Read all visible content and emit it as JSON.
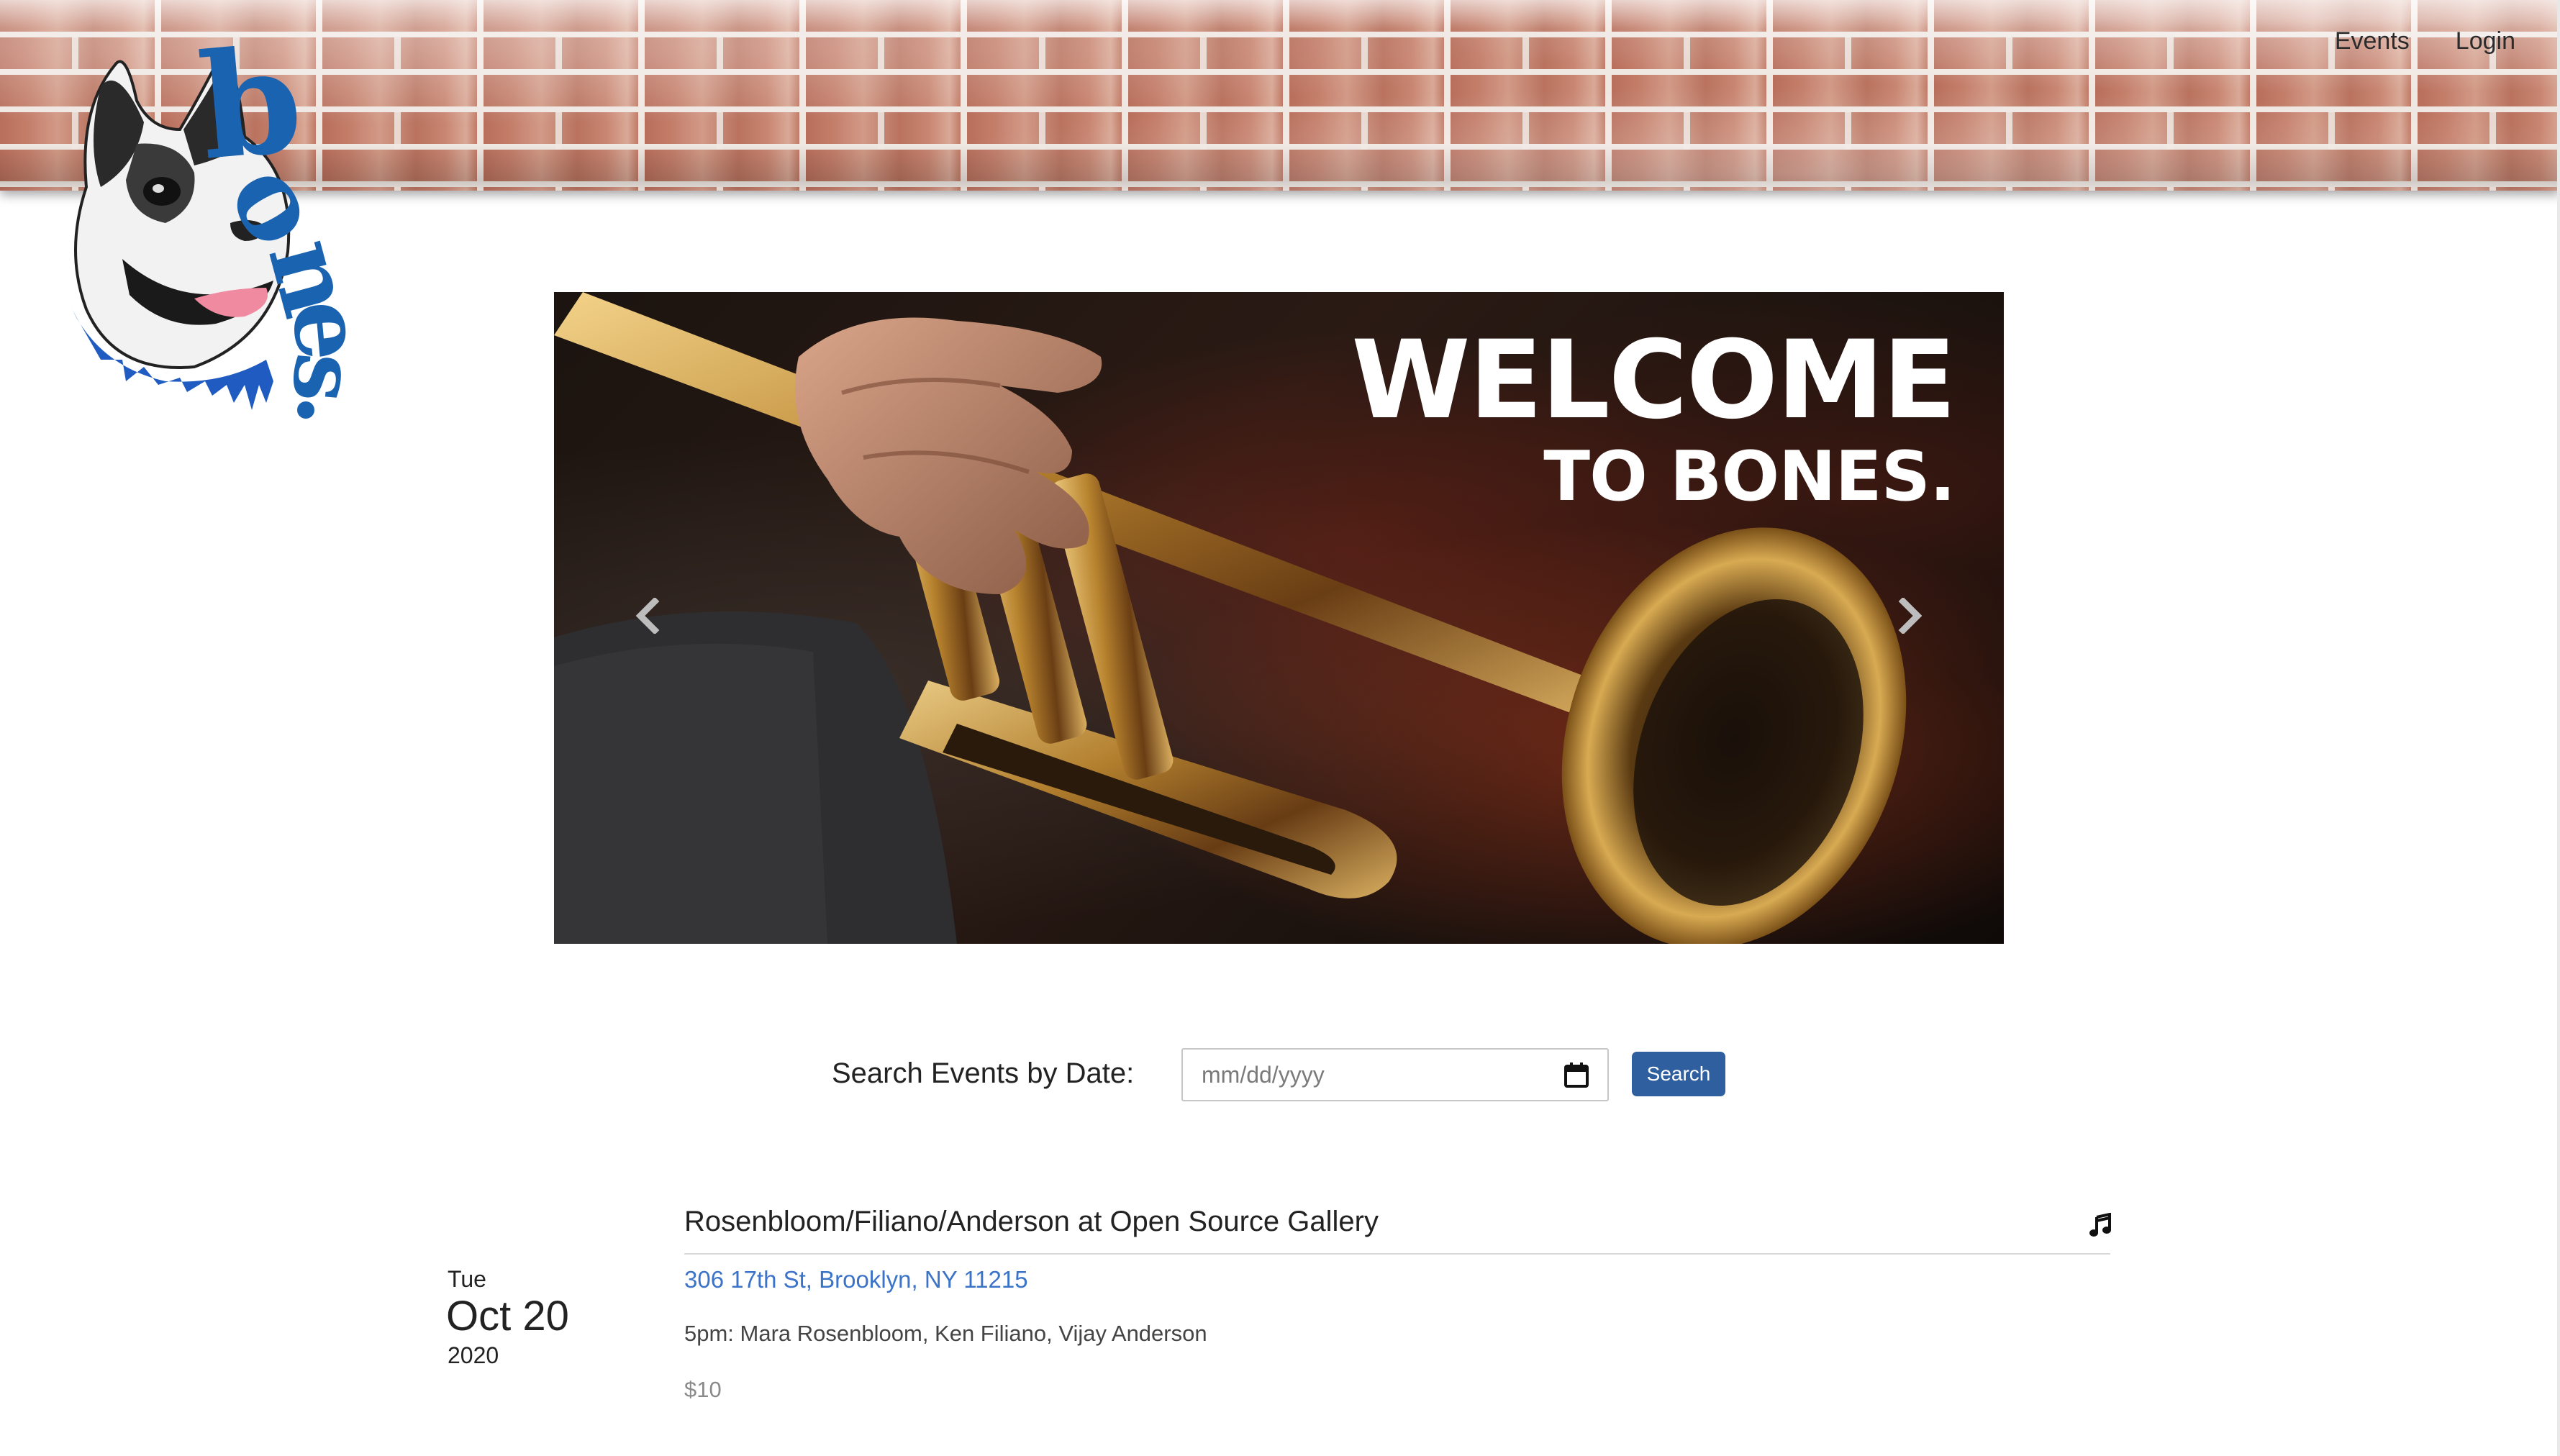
{
  "nav": {
    "events": "Events",
    "login": "Login"
  },
  "logo": {
    "text": "bones."
  },
  "carousel": {
    "headline": "WELCOME",
    "subheadline": "TO BONES."
  },
  "search": {
    "label": "Search Events by Date:",
    "placeholder": "mm/dd/yyyy",
    "button": "Search"
  },
  "event": {
    "weekday": "Tue",
    "date": "Oct 20",
    "year": "2020",
    "title": "Rosenbloom/Filiano/Anderson at Open Source Gallery",
    "address": "306 17th St, Brooklyn, NY 11215",
    "description": "5pm: Mara Rosenbloom, Ken Filiano, Vijay Anderson",
    "price": "$10",
    "icon": "music-note-icon"
  },
  "colors": {
    "accent": "#2f5f9e",
    "link": "#3a73c8",
    "logo_blue": "#1a63b0"
  }
}
